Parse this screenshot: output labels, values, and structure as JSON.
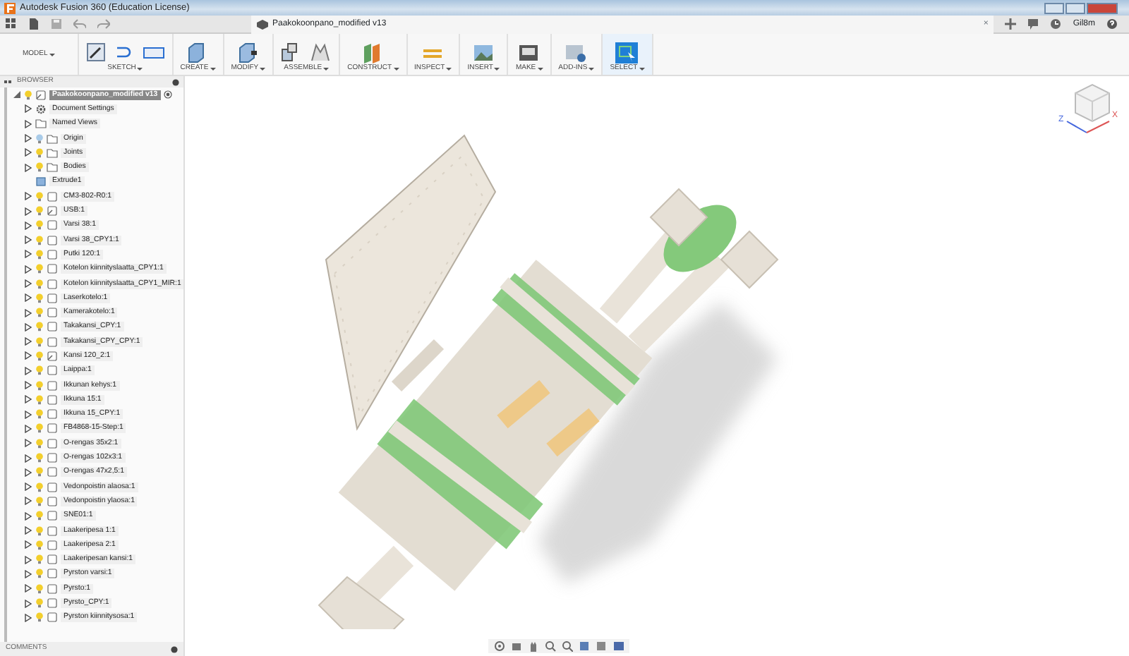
{
  "window": {
    "title": "Autodesk Fusion 360 (Education License)"
  },
  "document_tab": {
    "title": "Paakokoonpano_modified v13",
    "close": "×"
  },
  "user": "Gil8m",
  "workspace": {
    "label": "MODEL"
  },
  "toolbar_groups": [
    {
      "label": "SKETCH",
      "selected": false
    },
    {
      "label": "CREATE",
      "selected": false
    },
    {
      "label": "MODIFY",
      "selected": false
    },
    {
      "label": "ASSEMBLE",
      "selected": false
    },
    {
      "label": "CONSTRUCT",
      "selected": false
    },
    {
      "label": "INSPECT",
      "selected": false
    },
    {
      "label": "INSERT",
      "selected": false
    },
    {
      "label": "MAKE",
      "selected": false
    },
    {
      "label": "ADD-INS",
      "selected": false
    },
    {
      "label": "SELECT",
      "selected": true
    }
  ],
  "browser": {
    "title": "BROWSER",
    "root": {
      "label": "Paakokoonpano_modified v13",
      "expanded": true,
      "visible": true,
      "selected": true,
      "children": [
        {
          "label": "Document Settings",
          "kind": "settings",
          "expanded": false,
          "selected": false
        },
        {
          "label": "Named Views",
          "kind": "folder",
          "expanded": false,
          "selected": false
        },
        {
          "label": "Origin",
          "kind": "folder",
          "expanded": false,
          "visible": false,
          "selected": false
        },
        {
          "label": "Joints",
          "kind": "folder",
          "expanded": false,
          "visible": true,
          "selected": false
        },
        {
          "label": "Bodies",
          "kind": "folder",
          "expanded": false,
          "visible": true,
          "selected": false
        },
        {
          "label": "Extrude1",
          "kind": "feature",
          "selected": false
        },
        {
          "label": "CM3-802-R0:1",
          "kind": "component",
          "expanded": false,
          "visible": true,
          "selected": false
        },
        {
          "label": "USB:1",
          "kind": "linked",
          "expanded": false,
          "visible": true,
          "selected": false
        },
        {
          "label": "Varsi 38:1",
          "kind": "component",
          "expanded": false,
          "visible": true,
          "selected": false
        },
        {
          "label": "Varsi 38_CPY1:1",
          "kind": "component",
          "expanded": false,
          "visible": true,
          "selected": false
        },
        {
          "label": "Putki 120:1",
          "kind": "component",
          "expanded": false,
          "visible": true,
          "selected": false
        },
        {
          "label": "Kotelon kiinnityslaatta_CPY1:1",
          "kind": "component",
          "expanded": false,
          "visible": true,
          "selected": false
        },
        {
          "label": "Kotelon kiinnityslaatta_CPY1_MIR:1",
          "kind": "component",
          "expanded": false,
          "visible": true,
          "selected": false
        },
        {
          "label": "Laserkotelo:1",
          "kind": "component",
          "expanded": false,
          "visible": true,
          "selected": false
        },
        {
          "label": "Kamerakotelo:1",
          "kind": "component",
          "expanded": false,
          "visible": true,
          "selected": false
        },
        {
          "label": "Takakansi_CPY:1",
          "kind": "component",
          "expanded": false,
          "visible": true,
          "selected": false
        },
        {
          "label": "Takakansi_CPY_CPY:1",
          "kind": "component",
          "expanded": false,
          "visible": true,
          "selected": false
        },
        {
          "label": "Kansi 120_2:1",
          "kind": "linked",
          "expanded": false,
          "visible": true,
          "selected": false
        },
        {
          "label": "Laippa:1",
          "kind": "component",
          "expanded": false,
          "visible": true,
          "selected": false
        },
        {
          "label": "Ikkunan kehys:1",
          "kind": "component",
          "expanded": false,
          "visible": true,
          "selected": false
        },
        {
          "label": "Ikkuna 15:1",
          "kind": "component",
          "expanded": false,
          "visible": true,
          "selected": false
        },
        {
          "label": "Ikkuna 15_CPY:1",
          "kind": "component",
          "expanded": false,
          "visible": true,
          "selected": false
        },
        {
          "label": "FB4868-15-Step:1",
          "kind": "component",
          "expanded": false,
          "visible": true,
          "selected": false
        },
        {
          "label": "O-rengas 35x2:1",
          "kind": "component",
          "expanded": false,
          "visible": true,
          "selected": false
        },
        {
          "label": "O-rengas 102x3:1",
          "kind": "component",
          "expanded": false,
          "visible": true,
          "selected": false
        },
        {
          "label": "O-rengas 47x2,5:1",
          "kind": "component",
          "expanded": false,
          "visible": true,
          "selected": false
        },
        {
          "label": "Vedonpoistin alaosa:1",
          "kind": "component",
          "expanded": false,
          "visible": true,
          "selected": false
        },
        {
          "label": "Vedonpoistin ylaosa:1",
          "kind": "component",
          "expanded": false,
          "visible": true,
          "selected": false
        },
        {
          "label": "SNE01:1",
          "kind": "component",
          "expanded": false,
          "visible": true,
          "selected": false
        },
        {
          "label": "Laakeripesa 1:1",
          "kind": "component",
          "expanded": false,
          "visible": true,
          "selected": false
        },
        {
          "label": "Laakeripesa 2:1",
          "kind": "component",
          "expanded": false,
          "visible": true,
          "selected": false
        },
        {
          "label": "Laakeripesan kansi:1",
          "kind": "component",
          "expanded": false,
          "visible": true,
          "selected": false
        },
        {
          "label": "Pyrston varsi:1",
          "kind": "component",
          "expanded": false,
          "visible": true,
          "selected": false
        },
        {
          "label": "Pyrsto:1",
          "kind": "component",
          "expanded": false,
          "visible": true,
          "selected": false
        },
        {
          "label": "Pyrsto_CPY:1",
          "kind": "component",
          "expanded": false,
          "visible": true,
          "selected": false
        },
        {
          "label": "Pyrston kiinnitysosa:1",
          "kind": "component",
          "expanded": false,
          "visible": true,
          "selected": false
        }
      ]
    }
  },
  "view_cube": {
    "axes": [
      "Z",
      "X"
    ]
  },
  "comments": {
    "title": "COMMENTS"
  }
}
